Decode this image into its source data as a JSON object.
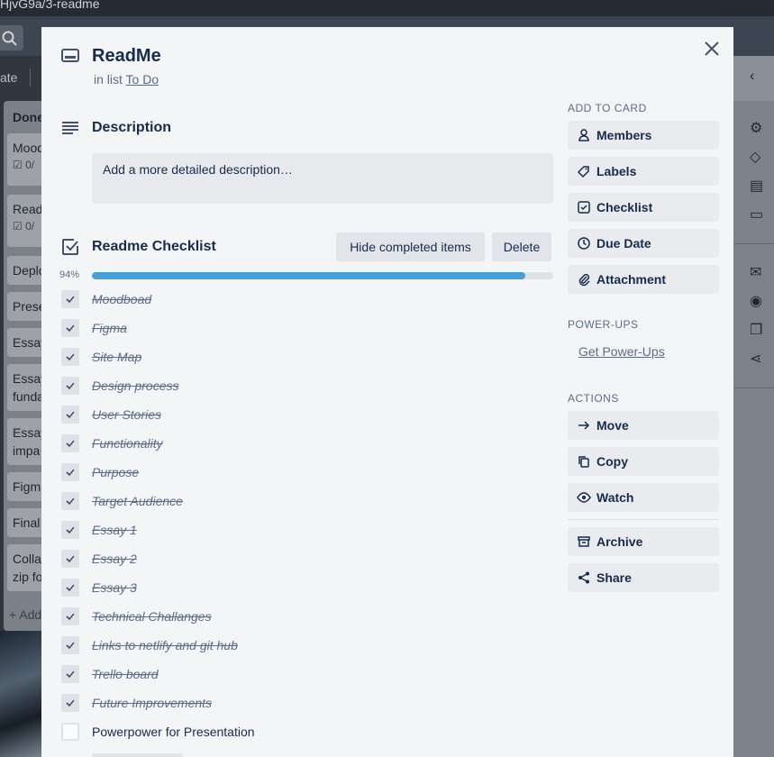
{
  "browser": {
    "url_fragment": "HjvG9a/3-readme"
  },
  "board": {
    "toolbar_fragment": "ate",
    "list_title": "Done",
    "cards": [
      {
        "line1": "Mood",
        "meta": "☑ 0/"
      },
      {
        "line1": "Read",
        "meta": "☑ 0/"
      },
      {
        "line1": "Deplo"
      },
      {
        "line1": "Prese"
      },
      {
        "line1": "Essay"
      },
      {
        "line1": "Essay",
        "line2": "funda"
      },
      {
        "line1": "Essay",
        "line2": "impa"
      },
      {
        "line1": "Figm"
      },
      {
        "line1": "Final"
      },
      {
        "line1": "Colla",
        "line2": "zip fo"
      }
    ],
    "add_card": "+ Add"
  },
  "card": {
    "title": "ReadMe",
    "in_list_prefix": "in list",
    "list_name": "To Do"
  },
  "description": {
    "heading": "Description",
    "placeholder": "Add a more detailed description…"
  },
  "checklist": {
    "title": "Readme Checklist",
    "hide_completed_label": "Hide completed items",
    "delete_label": "Delete",
    "percent_label": "94%",
    "progress": 0.94,
    "items": [
      {
        "text": "Moodboad",
        "done": true
      },
      {
        "text": "Figma",
        "done": true
      },
      {
        "text": "Site Map",
        "done": true
      },
      {
        "text": "Design process",
        "done": true
      },
      {
        "text": "User Stories",
        "done": true
      },
      {
        "text": "Functionality",
        "done": true
      },
      {
        "text": "Purpose",
        "done": true
      },
      {
        "text": "Target Audience",
        "done": true
      },
      {
        "text": "Essay 1",
        "done": true
      },
      {
        "text": "Essay 2",
        "done": true
      },
      {
        "text": "Essay 3",
        "done": true
      },
      {
        "text": "Technical Challanges",
        "done": true
      },
      {
        "text": "Links to netlify and git hub",
        "done": true
      },
      {
        "text": "Trello board",
        "done": true
      },
      {
        "text": "Future Improvements",
        "done": true
      },
      {
        "text": "Powerpower for Presentation",
        "done": false
      }
    ]
  },
  "sidebar": {
    "add_to_card_heading": "ADD TO CARD",
    "add_to_card": [
      {
        "label": "Members",
        "icon": "person-icon"
      },
      {
        "label": "Labels",
        "icon": "tag-icon"
      },
      {
        "label": "Checklist",
        "icon": "checkbox-icon"
      },
      {
        "label": "Due Date",
        "icon": "clock-icon"
      },
      {
        "label": "Attachment",
        "icon": "paperclip-icon"
      }
    ],
    "powerups_heading": "POWER-UPS",
    "get_powerups": "Get Power-Ups",
    "actions_heading": "ACTIONS",
    "actions": [
      {
        "label": "Move",
        "icon": "arrow-right-icon"
      },
      {
        "label": "Copy",
        "icon": "copy-icon"
      },
      {
        "label": "Watch",
        "icon": "eye-icon"
      },
      {
        "label": "Archive",
        "icon": "archive-icon"
      },
      {
        "label": "Share",
        "icon": "share-icon"
      }
    ]
  },
  "colors": {
    "progress": "#44a0d6",
    "modal_bg": "#f4f5f7",
    "text": "#172b4d"
  }
}
